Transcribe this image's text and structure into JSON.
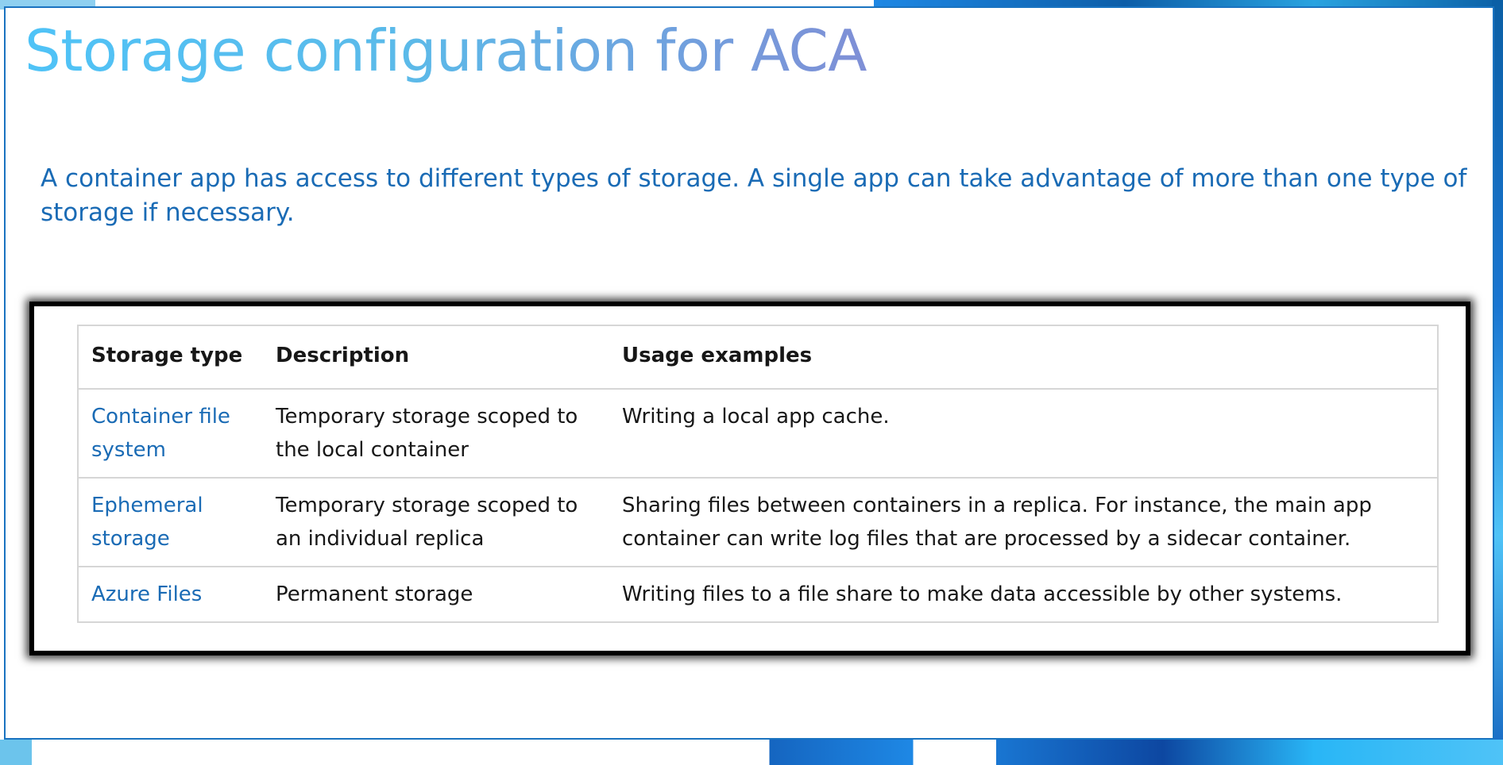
{
  "slide": {
    "title": "Storage configuration for ACA",
    "intro": "A container app has access to different types of storage. A single app can take advantage of more than one type of storage if necessary."
  },
  "table": {
    "headers": {
      "storage_type": "Storage type",
      "description": "Description",
      "usage_examples": "Usage examples"
    },
    "rows": [
      {
        "storage_type": "Container file system",
        "description": "Temporary storage scoped to the local container",
        "usage_examples": "Writing a local app cache."
      },
      {
        "storage_type": "Ephemeral storage",
        "description": "Temporary storage scoped to an individual replica",
        "usage_examples": "Sharing files between containers in a replica. For instance, the main app container can write log files that are processed by a sidecar container."
      },
      {
        "storage_type": "Azure Files",
        "description": "Permanent storage",
        "usage_examples": "Writing files to a file share to make data accessible by other systems."
      }
    ]
  },
  "colors": {
    "title_gradient_start": "#4fc3f7",
    "title_gradient_end": "#7f8fd6",
    "body_text": "#1a6bb5",
    "link": "#1a6bb5",
    "frame_border": "#1a73c0"
  }
}
